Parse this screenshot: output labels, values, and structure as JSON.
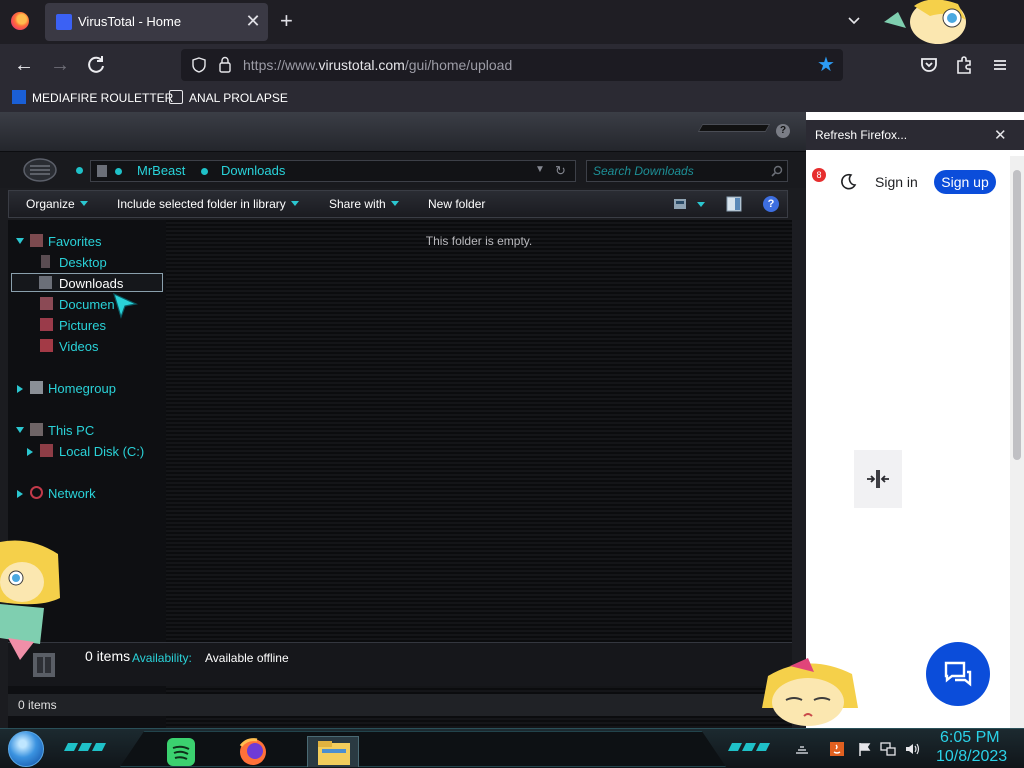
{
  "browser": {
    "tab": {
      "title": "VirusTotal - Home"
    },
    "url_prefix": "https://www.",
    "url_domain": "virustotal.com",
    "url_path": "/gui/home/upload",
    "bookmarks": [
      "MEDIAFIRE ROULETTER",
      "ANAL PROLAPSE"
    ],
    "accent": "#2c9cf6"
  },
  "page": {
    "notification": "Refresh Firefox...",
    "badge_count": "8",
    "signin": "Sign in",
    "signup": "Sign up",
    "brand_color": "#0b4dda"
  },
  "explorer": {
    "breadcrumb": [
      "MrBeast",
      "Downloads"
    ],
    "search_placeholder": "Search Downloads",
    "commands": [
      "Organize",
      "Include selected folder in library",
      "Share with",
      "New folder"
    ],
    "tree": {
      "favorites": "Favorites",
      "desktop": "Desktop",
      "downloads": "Downloads",
      "documents": "Documen",
      "pictures": "Pictures",
      "videos": "Videos",
      "homegroup": "Homegroup",
      "this_pc": "This PC",
      "local_disk": "Local Disk (C:)",
      "network": "Network"
    },
    "empty_message": "This folder is empty.",
    "details_count": "0 items",
    "availability_label": "Availability:",
    "availability_value": "Available offline",
    "status_text": "0 items",
    "accent": "#2ad2d8"
  },
  "taskbar": {
    "time": "6:05 PM",
    "date": "10/8/2023",
    "apps": [
      "spotify-icon",
      "firefox-icon",
      "file-explorer-icon"
    ]
  }
}
